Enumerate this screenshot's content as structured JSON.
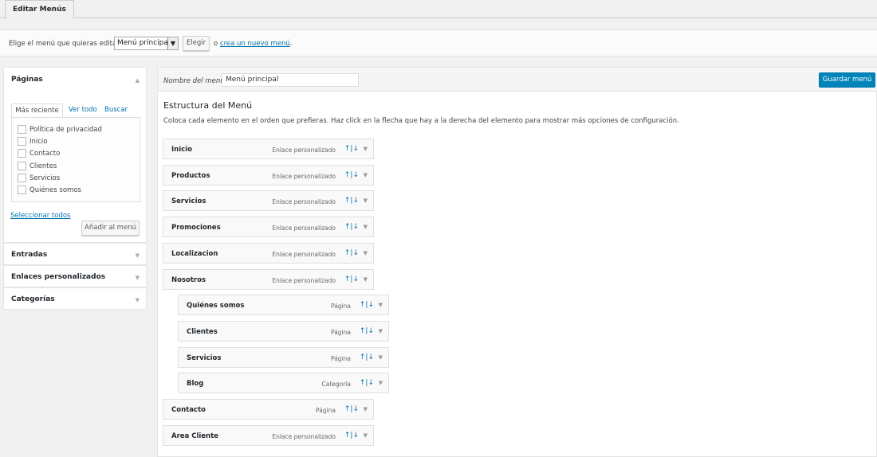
{
  "tab": {
    "label": "Editar Menús"
  },
  "select_bar": {
    "label": "Elige el menú que quieras editar:",
    "selected_menu": "Menú principal",
    "choose_button": "Elegir",
    "or_text": "o",
    "create_link": "crea un nuevo menú",
    "period": "."
  },
  "pages_box": {
    "title": "Páginas",
    "tabs": [
      "Más reciente",
      "Ver todo",
      "Buscar"
    ],
    "items": [
      "Política de privacidad",
      "Inicio",
      "Contacto",
      "Clientes",
      "Servicios",
      "Quiénes somos"
    ],
    "select_all": "Seleccionar todos",
    "add_button": "Añadir al menú"
  },
  "collapsed_boxes": [
    "Entradas",
    "Enlaces personalizados",
    "Categorías"
  ],
  "menu": {
    "name_label": "Nombre del menú",
    "name_value": "Menú principal",
    "save_button": "Guardar menú",
    "structure_title": "Estructura del Menú",
    "structure_desc": "Coloca cada elemento en el orden que prefieras. Haz click en la flecha que hay a la derecha del elemento para mostrar más opciones de configuración.",
    "move_arrows": "↑|↓",
    "items": [
      {
        "title": "Inicio",
        "type": "Enlace personalizado",
        "depth": 0
      },
      {
        "title": "Productos",
        "type": "Enlace personalizado",
        "depth": 0
      },
      {
        "title": "Servicios",
        "type": "Enlace personalizado",
        "depth": 0
      },
      {
        "title": "Promociones",
        "type": "Enlace personalizado",
        "depth": 0
      },
      {
        "title": "Localizacion",
        "type": "Enlace personalizado",
        "depth": 0
      },
      {
        "title": "Nosotros",
        "type": "Enlace personalizado",
        "depth": 0
      },
      {
        "title": "Quiénes somos",
        "type": "Página",
        "depth": 1
      },
      {
        "title": "Clientes",
        "type": "Página",
        "depth": 1
      },
      {
        "title": "Servicios",
        "type": "Página",
        "depth": 1
      },
      {
        "title": "Blog",
        "type": "Categoría",
        "depth": 1
      },
      {
        "title": "Contacto",
        "type": "Página",
        "depth": 0
      },
      {
        "title": "Area Cliente",
        "type": "Enlace personalizado",
        "depth": 0
      }
    ]
  }
}
